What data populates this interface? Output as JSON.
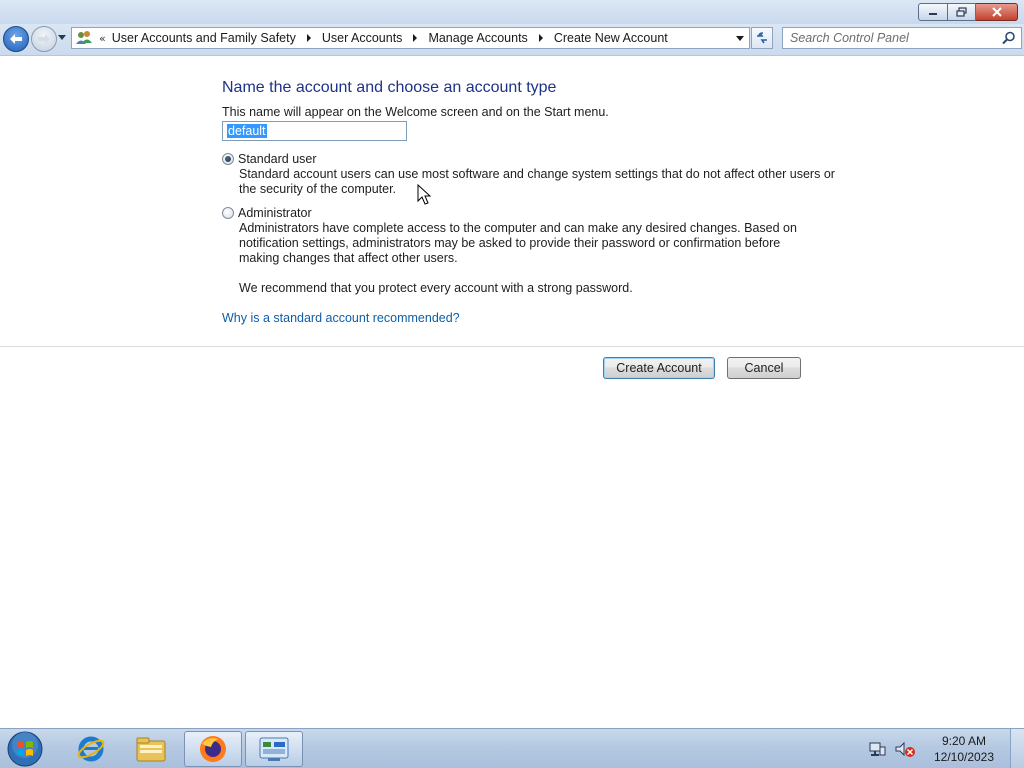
{
  "window": {
    "controls": {
      "minimize": "minimize",
      "maximize": "restore",
      "close": "close"
    }
  },
  "navigation": {
    "breadcrumb_prefix": "«",
    "breadcrumbs": [
      "User Accounts and Family Safety",
      "User Accounts",
      "Manage Accounts",
      "Create New Account"
    ],
    "search_placeholder": "Search Control Panel"
  },
  "form": {
    "heading": "Name the account and choose an account type",
    "subtext": "This name will appear on the Welcome screen and on the Start menu.",
    "name_value": "default",
    "options": [
      {
        "label": "Standard user",
        "checked": true,
        "description_lines": [
          "Standard account users can use most software and change system settings that do not affect other users or",
          "the security of the computer."
        ]
      },
      {
        "label": "Administrator",
        "checked": false,
        "description_lines": [
          "Administrators have complete access to the computer and can make any desired changes. Based on",
          "notification settings, administrators may be asked to provide their password or confirmation before",
          "making changes that affect other users."
        ]
      }
    ],
    "recommendation": "We recommend that you protect every account with a strong password.",
    "help_link": "Why is a standard account recommended?",
    "create_button": "Create Account",
    "cancel_button": "Cancel"
  },
  "taskbar": {
    "items": [
      "start-orb",
      "internet-explorer-icon",
      "windows-explorer-icon",
      "firefox-icon",
      "control-panel-icon"
    ],
    "clock_time": "9:20 AM",
    "clock_date": "12/10/2023"
  },
  "colors": {
    "heading": "#1e3287",
    "link": "#0e5ea8",
    "selection": "#3399ff"
  }
}
